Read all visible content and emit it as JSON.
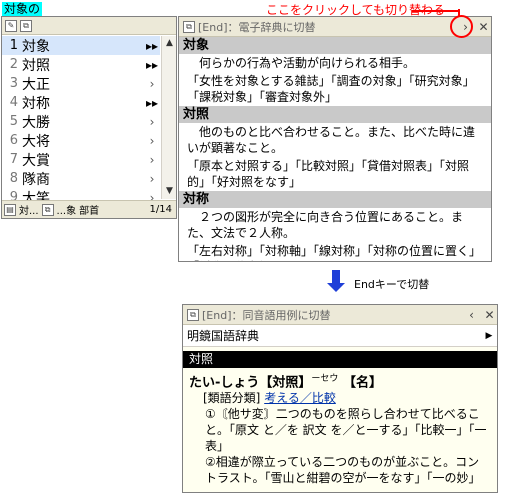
{
  "query": "対象の",
  "annotation": "ここをクリックしても切り替わる",
  "list": {
    "rows": [
      {
        "num": "1",
        "word": "対象",
        "arrow": "▸▸",
        "bold": true,
        "selected": true
      },
      {
        "num": "2",
        "word": "対照",
        "arrow": "▸▸",
        "bold": true,
        "selected": false
      },
      {
        "num": "3",
        "word": "大正",
        "arrow": "›",
        "bold": false,
        "selected": false
      },
      {
        "num": "4",
        "word": "対称",
        "arrow": "▸▸",
        "bold": true,
        "selected": false
      },
      {
        "num": "5",
        "word": "大勝",
        "arrow": "›",
        "bold": false,
        "selected": false
      },
      {
        "num": "6",
        "word": "大将",
        "arrow": "›",
        "bold": false,
        "selected": false
      },
      {
        "num": "7",
        "word": "大賞",
        "arrow": "›",
        "bold": false,
        "selected": false
      },
      {
        "num": "8",
        "word": "隊商",
        "arrow": "›",
        "bold": false,
        "selected": false
      },
      {
        "num": "9",
        "word": "大笑",
        "arrow": "›",
        "bold": false,
        "selected": false
      }
    ],
    "footer": {
      "f1": "対...",
      "f2": "...象",
      "f3": "部首",
      "page": "1/14"
    }
  },
  "dict1": {
    "title": "[End]：電子辞典に切替",
    "entries": [
      {
        "head": "対象",
        "lines": [
          "何らかの行為や活動が向けられる相手。",
          "「女性を対象とする雑誌」「調査の対象」「研究対象」「課税対象」「審査対象外」"
        ]
      },
      {
        "head": "対照",
        "lines": [
          "他のものと比べ合わせること。また、比べた時に違いが顕著なこと。",
          "「原本と対照する」「比較対照」「貸借対照表」「対照的」「好対照をなす」"
        ]
      },
      {
        "head": "対称",
        "lines": [
          "２つの図形が完全に向き合う位置にあること。また、文法で２人称。",
          "「左右対称」「対称軸」「線対称」「対称の位置に置く」「対称の代名詞」"
        ]
      }
    ]
  },
  "arrow_label": "Endキーで切替",
  "dict2": {
    "title": "[End]：同音語用例に切替",
    "dict_name": "明鏡国語辞典",
    "entry_head": "対照",
    "headword": "たい‐しょう【対照】",
    "headword_sup": "ーセウ",
    "pos": "【名】",
    "ruigo_label": "[類語分類]",
    "ruigo_link": "考える／比較",
    "para1": "①〘他サ変〙二つのものを照らし合わせて比べること。「原文 と／を 訳文 を／と一する」「比較一」「一表」",
    "para2": "②相違が際立っている二つのものが並ぶこと。コントラスト。「雪山と紺碧の空が一をなす」「一の妙」"
  }
}
